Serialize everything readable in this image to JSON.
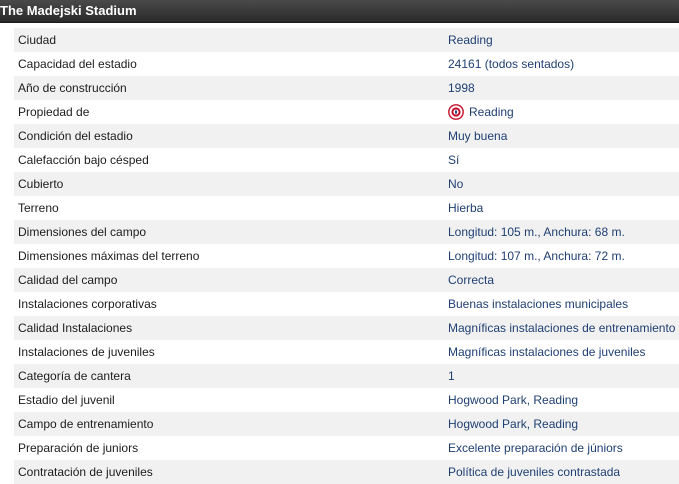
{
  "header": {
    "title": "The Madejski Stadium"
  },
  "colors": {
    "header_bg": "#333333",
    "value_text": "#1f3f73",
    "row_alt_bg": "#f1f1f1",
    "badge_red": "#c8102e"
  },
  "rows": [
    {
      "label": "Ciudad",
      "value": "Reading"
    },
    {
      "label": "Capacidad del estadio",
      "value": "24161 (todos sentados)"
    },
    {
      "label": "Año de construcción",
      "value": "1998"
    },
    {
      "label": "Propiedad de",
      "value": "Reading",
      "icon": "club-crest-icon"
    },
    {
      "label": "Condición del estadio",
      "value": "Muy buena"
    },
    {
      "label": "Calefacción bajo césped",
      "value": "Sí"
    },
    {
      "label": "Cubierto",
      "value": "No"
    },
    {
      "label": "Terreno",
      "value": "Hierba"
    },
    {
      "label": "Dimensiones del campo",
      "value": "Longitud: 105 m., Anchura: 68 m."
    },
    {
      "label": "Dimensiones máximas del terreno",
      "value": "Longitud: 107 m., Anchura: 72 m."
    },
    {
      "label": "Calidad del campo",
      "value": "Correcta"
    },
    {
      "label": "Instalaciones corporativas",
      "value": "Buenas instalaciones municipales"
    },
    {
      "label": "Calidad Instalaciones",
      "value": "Magníficas instalaciones de entrenamiento"
    },
    {
      "label": "Instalaciones de juveniles",
      "value": "Magníficas instalaciones de juveniles"
    },
    {
      "label": "Categoría de cantera",
      "value": "1"
    },
    {
      "label": "Estadio del juvenil",
      "value": "Hogwood Park, Reading"
    },
    {
      "label": "Campo de entrenamiento",
      "value": "Hogwood Park, Reading"
    },
    {
      "label": "Preparación de juniors",
      "value": "Excelente preparación de júniors"
    },
    {
      "label": "Contratación de juveniles",
      "value": "Política de juveniles contrastada"
    }
  ]
}
